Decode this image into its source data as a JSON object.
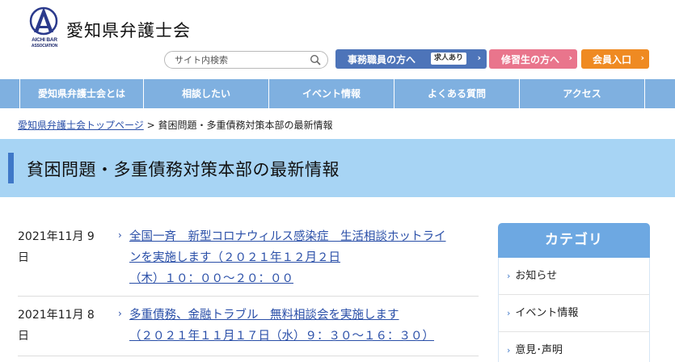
{
  "header": {
    "logo_text_line1": "AICHI BAR",
    "logo_text_line2": "ASSOCIATION",
    "site_title": "愛知県弁護士会",
    "search_placeholder": "サイト内検索",
    "btn_staff": "事務職員の方へ",
    "btn_staff_badge": "求人あり",
    "btn_trainee": "修習生の方へ",
    "btn_member": "会員入口",
    "chevron": "›"
  },
  "nav": {
    "items": [
      {
        "label": "愛知県弁護士会とは"
      },
      {
        "label": "相談したい"
      },
      {
        "label": "イベント情報"
      },
      {
        "label": "よくある質問"
      },
      {
        "label": "アクセス"
      }
    ]
  },
  "breadcrumb": {
    "home": "愛知県弁護士会トップページ",
    "separator": ">",
    "current": "貧困問題・多重債務対策本部の最新情報"
  },
  "page_title": "貧困問題・多重債務対策本部の最新情報",
  "news": [
    {
      "date_line1": "2021年11月 9",
      "date_line2": "日",
      "link_line1": "全国一斉　新型コロナウィルス感染症　生活相談ホットライ",
      "link_line2": "ンを実施します（２０２１年１２月２日",
      "link_line3": "（木）１０：００～２０：００"
    },
    {
      "date_line1": "2021年11月 8",
      "date_line2": "日",
      "link_line1": "多重債務、金融トラブル　無料相談会を実施します",
      "link_line2": "（２０２１年１１月１７日（水）９：３０～１６：３０）"
    }
  ],
  "sidebar": {
    "title": "カテゴリ",
    "items": [
      {
        "label": "お知らせ"
      },
      {
        "label": "イベント情報"
      },
      {
        "label": "意見･声明"
      }
    ]
  },
  "colors": {
    "nav_bg": "#7fb0e0",
    "title_band": "#a7d4f4",
    "accent_blue": "#4d74b9",
    "accent_pink": "#e9758c",
    "accent_orange": "#ef8a22",
    "link": "#2a4fa8"
  }
}
